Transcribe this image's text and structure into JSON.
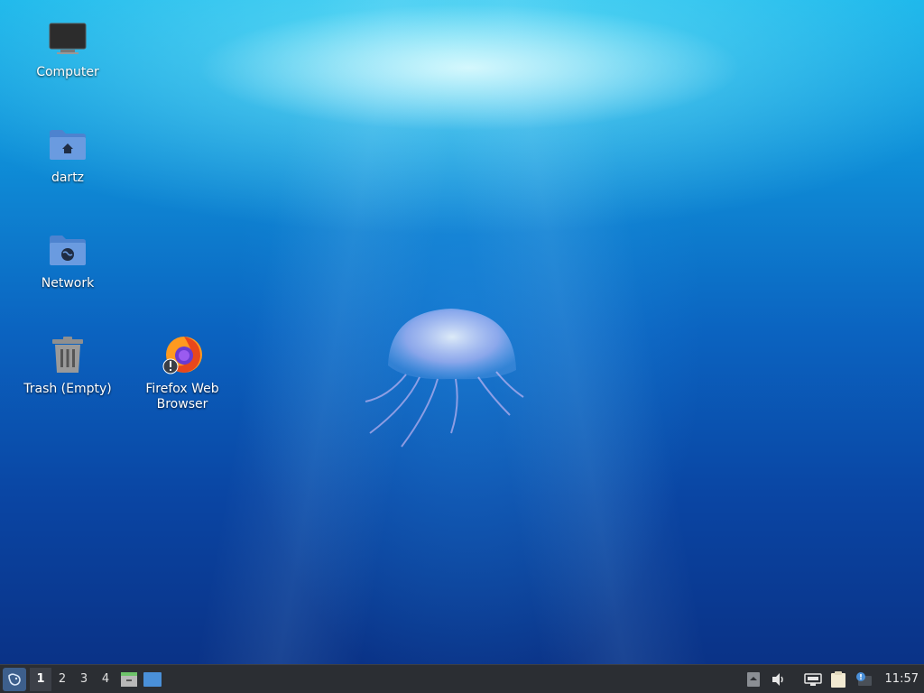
{
  "desktop": {
    "icons": [
      {
        "label": "Computer"
      },
      {
        "label": "dartz"
      },
      {
        "label": "Network"
      },
      {
        "label": "Trash (Empty)"
      },
      {
        "label": "Firefox Web Browser"
      }
    ]
  },
  "taskbar": {
    "workspaces": [
      "1",
      "2",
      "3",
      "4"
    ],
    "active_workspace": "1",
    "clock": "11:57"
  },
  "colors": {
    "taskbar_bg": "#2b2e33",
    "folder_blue": "#5b8fd6",
    "accent": "#4a90d9"
  }
}
